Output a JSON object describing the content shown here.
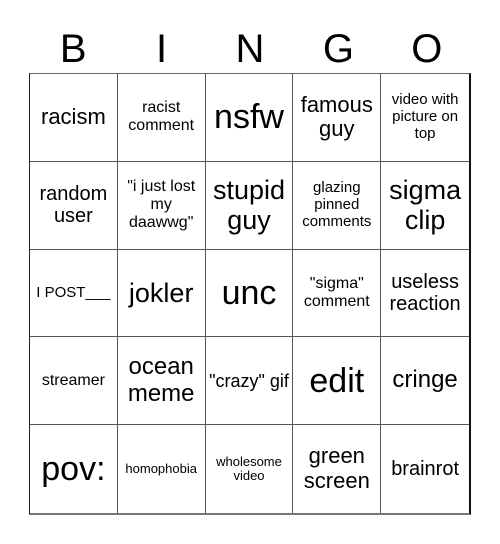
{
  "header": [
    "B",
    "I",
    "N",
    "G",
    "O"
  ],
  "cells": [
    "racism",
    "racist comment",
    "nsfw",
    "famous guy",
    "video with picture on top",
    "random user",
    "\"i just lost my daawwg\"",
    "stupid guy",
    "glazing pinned comments",
    "sigma clip",
    "I POST___",
    "jokler",
    "unc",
    "\"sigma\" comment",
    "useless reaction",
    "streamer",
    "ocean meme",
    "\"crazy\" gif",
    "edit",
    "cringe",
    "pov:",
    "homophobia",
    "wholesome video",
    "green screen",
    "brainrot"
  ]
}
